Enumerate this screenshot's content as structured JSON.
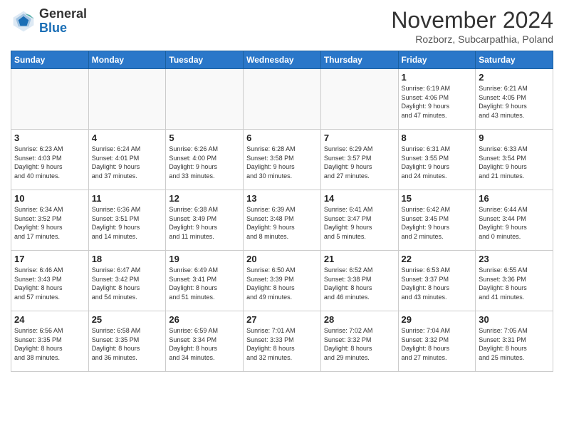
{
  "header": {
    "logo_general": "General",
    "logo_blue": "Blue",
    "month_title": "November 2024",
    "subtitle": "Rozborz, Subcarpathia, Poland"
  },
  "weekdays": [
    "Sunday",
    "Monday",
    "Tuesday",
    "Wednesday",
    "Thursday",
    "Friday",
    "Saturday"
  ],
  "weeks": [
    [
      {
        "day": "",
        "info": ""
      },
      {
        "day": "",
        "info": ""
      },
      {
        "day": "",
        "info": ""
      },
      {
        "day": "",
        "info": ""
      },
      {
        "day": "",
        "info": ""
      },
      {
        "day": "1",
        "info": "Sunrise: 6:19 AM\nSunset: 4:06 PM\nDaylight: 9 hours\nand 47 minutes."
      },
      {
        "day": "2",
        "info": "Sunrise: 6:21 AM\nSunset: 4:05 PM\nDaylight: 9 hours\nand 43 minutes."
      }
    ],
    [
      {
        "day": "3",
        "info": "Sunrise: 6:23 AM\nSunset: 4:03 PM\nDaylight: 9 hours\nand 40 minutes."
      },
      {
        "day": "4",
        "info": "Sunrise: 6:24 AM\nSunset: 4:01 PM\nDaylight: 9 hours\nand 37 minutes."
      },
      {
        "day": "5",
        "info": "Sunrise: 6:26 AM\nSunset: 4:00 PM\nDaylight: 9 hours\nand 33 minutes."
      },
      {
        "day": "6",
        "info": "Sunrise: 6:28 AM\nSunset: 3:58 PM\nDaylight: 9 hours\nand 30 minutes."
      },
      {
        "day": "7",
        "info": "Sunrise: 6:29 AM\nSunset: 3:57 PM\nDaylight: 9 hours\nand 27 minutes."
      },
      {
        "day": "8",
        "info": "Sunrise: 6:31 AM\nSunset: 3:55 PM\nDaylight: 9 hours\nand 24 minutes."
      },
      {
        "day": "9",
        "info": "Sunrise: 6:33 AM\nSunset: 3:54 PM\nDaylight: 9 hours\nand 21 minutes."
      }
    ],
    [
      {
        "day": "10",
        "info": "Sunrise: 6:34 AM\nSunset: 3:52 PM\nDaylight: 9 hours\nand 17 minutes."
      },
      {
        "day": "11",
        "info": "Sunrise: 6:36 AM\nSunset: 3:51 PM\nDaylight: 9 hours\nand 14 minutes."
      },
      {
        "day": "12",
        "info": "Sunrise: 6:38 AM\nSunset: 3:49 PM\nDaylight: 9 hours\nand 11 minutes."
      },
      {
        "day": "13",
        "info": "Sunrise: 6:39 AM\nSunset: 3:48 PM\nDaylight: 9 hours\nand 8 minutes."
      },
      {
        "day": "14",
        "info": "Sunrise: 6:41 AM\nSunset: 3:47 PM\nDaylight: 9 hours\nand 5 minutes."
      },
      {
        "day": "15",
        "info": "Sunrise: 6:42 AM\nSunset: 3:45 PM\nDaylight: 9 hours\nand 2 minutes."
      },
      {
        "day": "16",
        "info": "Sunrise: 6:44 AM\nSunset: 3:44 PM\nDaylight: 9 hours\nand 0 minutes."
      }
    ],
    [
      {
        "day": "17",
        "info": "Sunrise: 6:46 AM\nSunset: 3:43 PM\nDaylight: 8 hours\nand 57 minutes."
      },
      {
        "day": "18",
        "info": "Sunrise: 6:47 AM\nSunset: 3:42 PM\nDaylight: 8 hours\nand 54 minutes."
      },
      {
        "day": "19",
        "info": "Sunrise: 6:49 AM\nSunset: 3:41 PM\nDaylight: 8 hours\nand 51 minutes."
      },
      {
        "day": "20",
        "info": "Sunrise: 6:50 AM\nSunset: 3:39 PM\nDaylight: 8 hours\nand 49 minutes."
      },
      {
        "day": "21",
        "info": "Sunrise: 6:52 AM\nSunset: 3:38 PM\nDaylight: 8 hours\nand 46 minutes."
      },
      {
        "day": "22",
        "info": "Sunrise: 6:53 AM\nSunset: 3:37 PM\nDaylight: 8 hours\nand 43 minutes."
      },
      {
        "day": "23",
        "info": "Sunrise: 6:55 AM\nSunset: 3:36 PM\nDaylight: 8 hours\nand 41 minutes."
      }
    ],
    [
      {
        "day": "24",
        "info": "Sunrise: 6:56 AM\nSunset: 3:35 PM\nDaylight: 8 hours\nand 38 minutes."
      },
      {
        "day": "25",
        "info": "Sunrise: 6:58 AM\nSunset: 3:35 PM\nDaylight: 8 hours\nand 36 minutes."
      },
      {
        "day": "26",
        "info": "Sunrise: 6:59 AM\nSunset: 3:34 PM\nDaylight: 8 hours\nand 34 minutes."
      },
      {
        "day": "27",
        "info": "Sunrise: 7:01 AM\nSunset: 3:33 PM\nDaylight: 8 hours\nand 32 minutes."
      },
      {
        "day": "28",
        "info": "Sunrise: 7:02 AM\nSunset: 3:32 PM\nDaylight: 8 hours\nand 29 minutes."
      },
      {
        "day": "29",
        "info": "Sunrise: 7:04 AM\nSunset: 3:32 PM\nDaylight: 8 hours\nand 27 minutes."
      },
      {
        "day": "30",
        "info": "Sunrise: 7:05 AM\nSunset: 3:31 PM\nDaylight: 8 hours\nand 25 minutes."
      }
    ]
  ]
}
